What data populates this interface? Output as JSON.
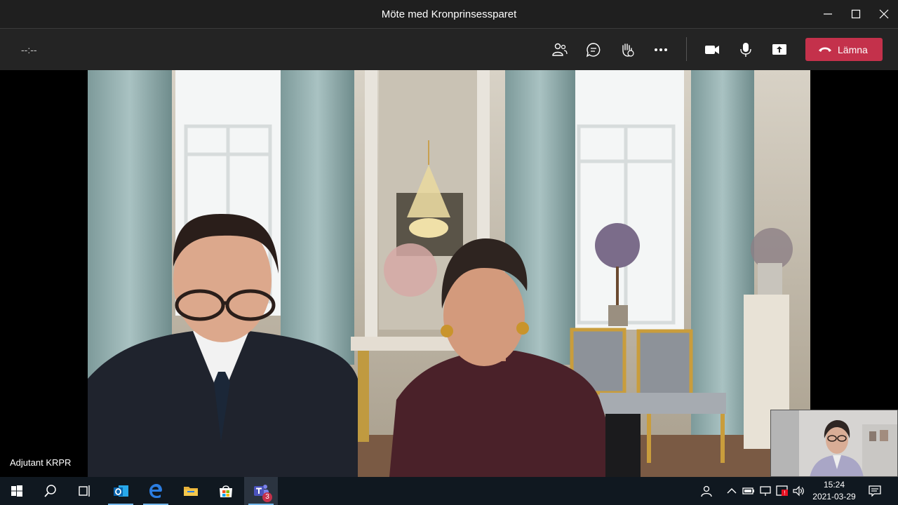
{
  "window": {
    "title": "Möte med Kronprinsessparet",
    "minimize_icon": "minimize-icon",
    "maximize_icon": "maximize-icon",
    "close_icon": "close-icon"
  },
  "meeting_bar": {
    "timer": "--:--",
    "buttons": [
      {
        "name": "participants-icon"
      },
      {
        "name": "chat-icon"
      },
      {
        "name": "raise-hand-icon"
      },
      {
        "name": "more-actions-icon"
      },
      {
        "name": "camera-icon"
      },
      {
        "name": "microphone-icon"
      },
      {
        "name": "share-screen-icon"
      }
    ],
    "leave_label": "Lämna",
    "leave_color": "#c4314b"
  },
  "stage": {
    "participant_name": "Adjutant KRPR"
  },
  "taskbar": {
    "apps": [
      "start-icon",
      "search-icon",
      "task-view-icon",
      "outlook-icon",
      "edge-icon",
      "file-explorer-icon",
      "store-icon",
      "teams-icon"
    ],
    "teams_badge": "3",
    "tray": [
      "people-icon",
      "show-hidden-icons-icon",
      "battery-icon",
      "network-icon",
      "alert-icon",
      "volume-icon"
    ],
    "time": "15:24",
    "date": "2021-03-29",
    "notification_icon": "action-center-icon"
  }
}
